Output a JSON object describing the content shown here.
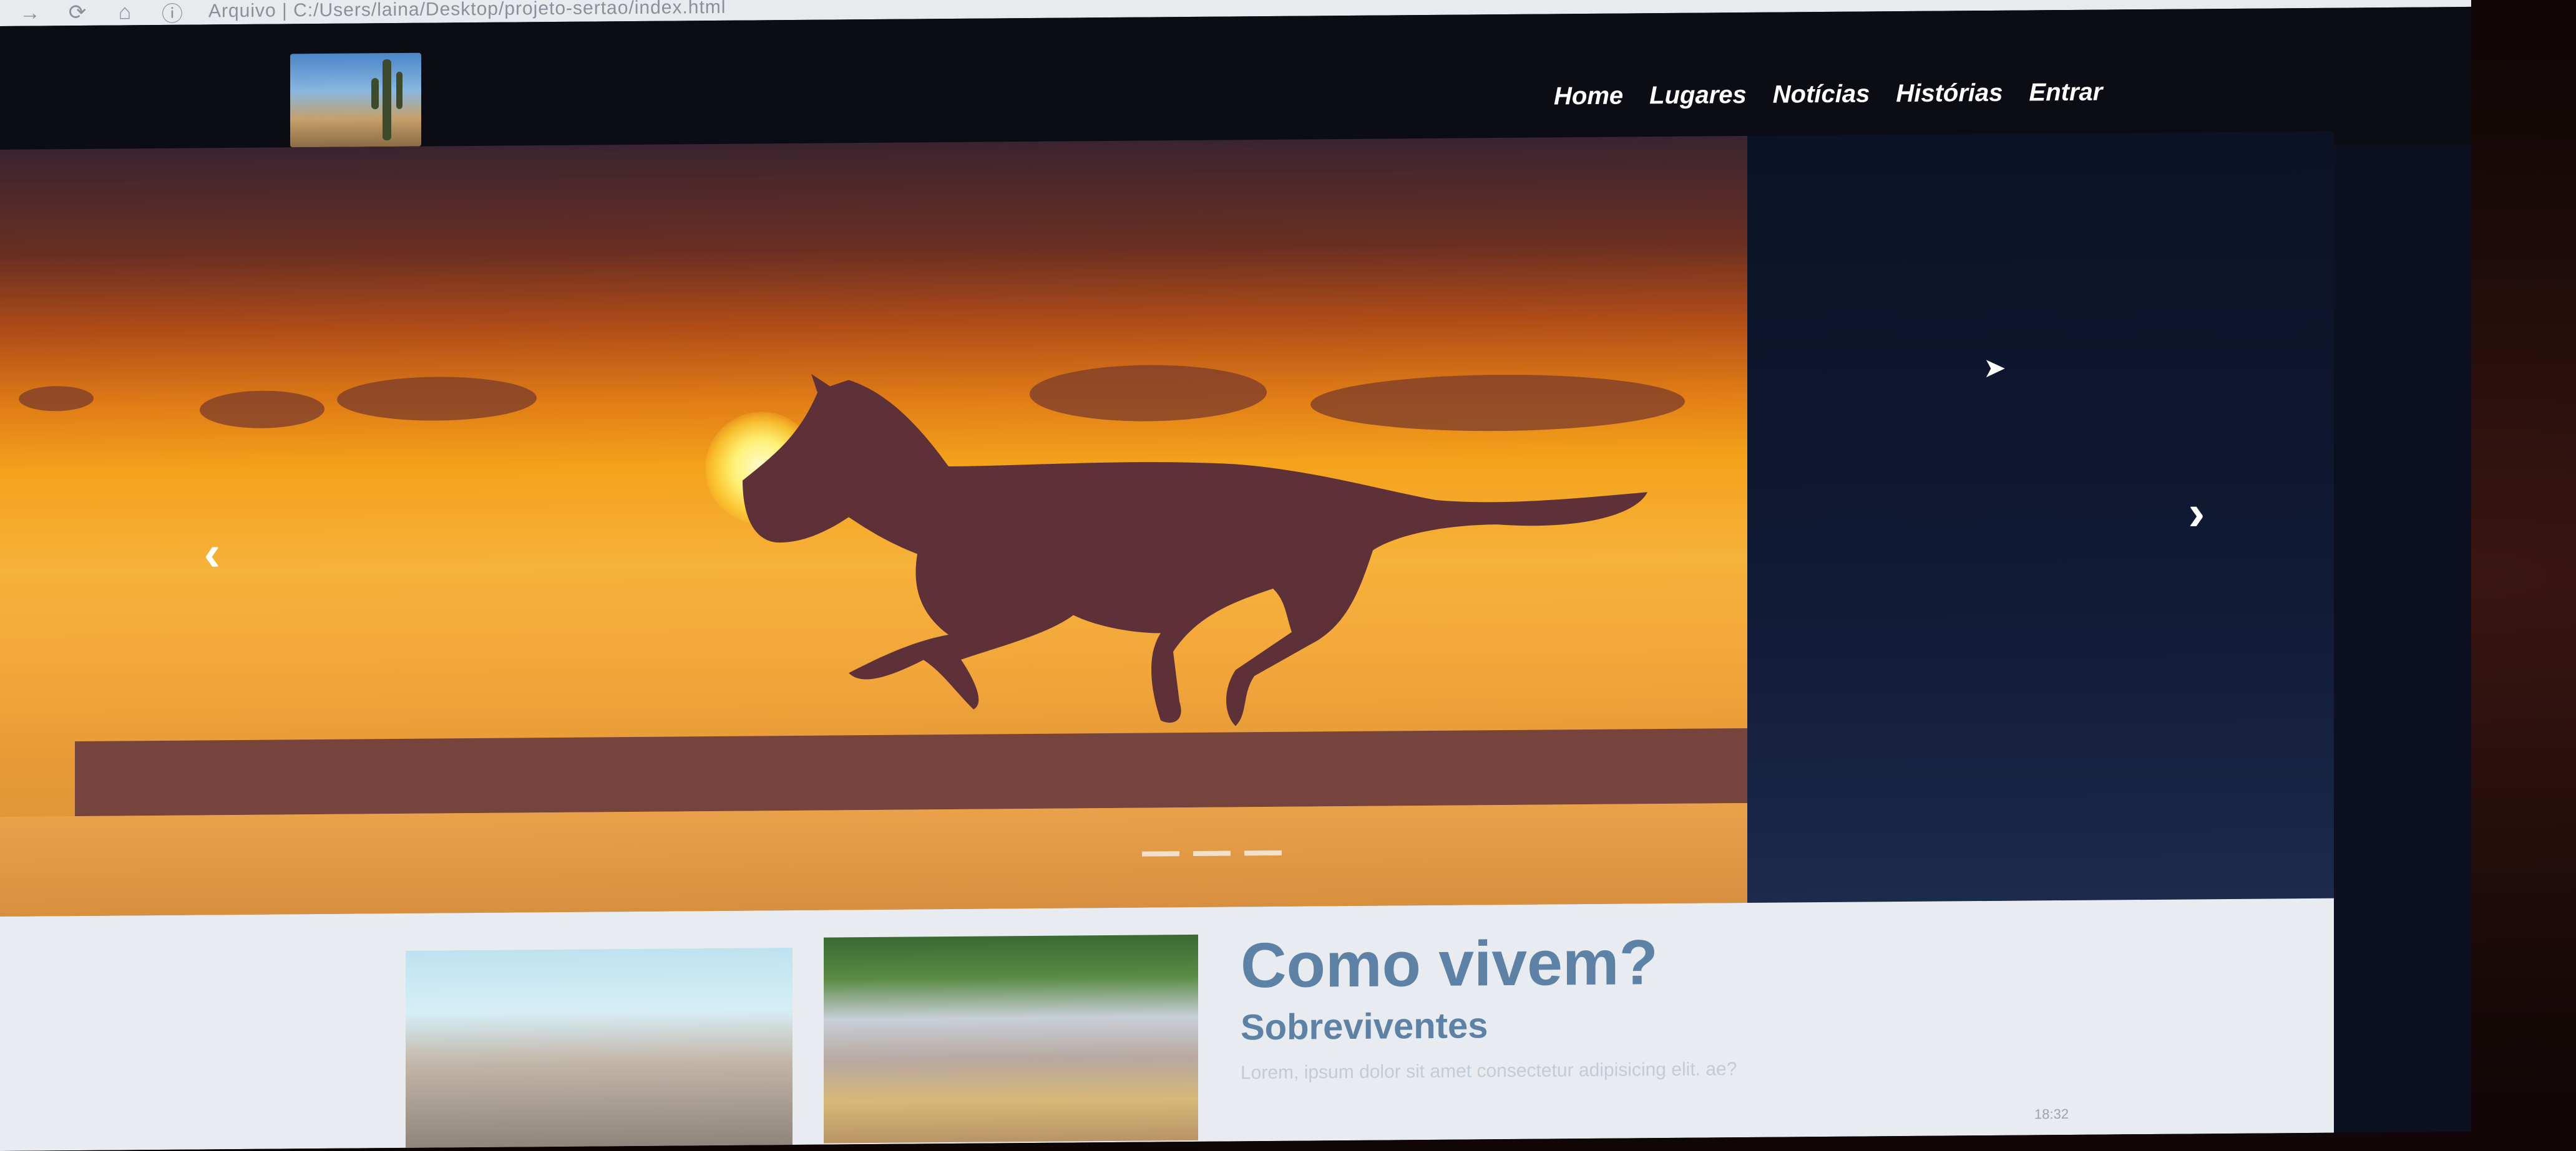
{
  "browser": {
    "back_icon": "arrow-right-icon",
    "url_text": "Arquivo  |  C:/Users/laina/Desktop/projeto-sertao/index.html"
  },
  "navbar": {
    "logo_alt": "logo",
    "links": [
      "Home",
      "Lugares",
      "Notícias",
      "Histórias",
      "Entrar"
    ]
  },
  "carousel": {
    "prev_icon": "chevron-left-icon",
    "next_icon": "chevron-right-icon",
    "prev_glyph": "‹",
    "next_glyph": "›",
    "indicator_count": 3
  },
  "content": {
    "title": "Como vivem?",
    "subtitle": "Sobreviventes",
    "text": "Lorem, ipsum dolor sit amet consectetur adipisicing elit. ae?"
  },
  "taskbar": {
    "time": "18:32"
  }
}
